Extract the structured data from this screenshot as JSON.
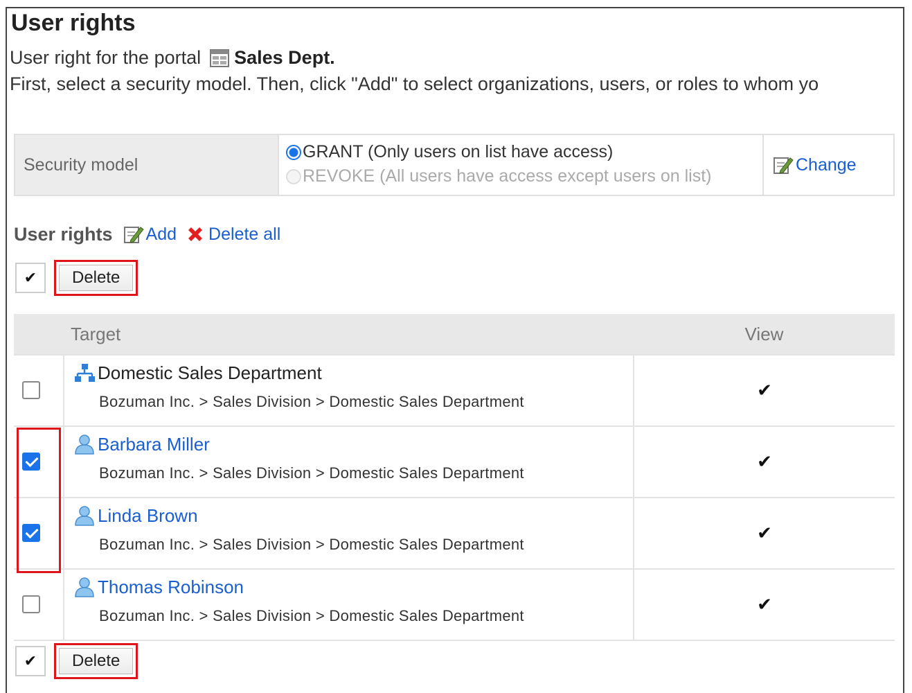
{
  "header": {
    "title": "User rights",
    "portal_prefix": "User right for the portal",
    "portal_name": "Sales Dept.",
    "instruction": "First, select a security model. Then, click \"Add\" to select organizations, users, or roles to whom yo"
  },
  "security": {
    "label": "Security model",
    "grant_label": "GRANT (Only users on list have access)",
    "revoke_label": "REVOKE (All users have access except users on list)",
    "change_label": "Change",
    "selected": "GRANT"
  },
  "user_rights": {
    "title": "User rights",
    "add_label": "Add",
    "delete_all_label": "Delete all"
  },
  "toolbar": {
    "select_all_glyph": "✔",
    "delete_label": "Delete"
  },
  "table": {
    "headers": [
      "",
      "Target",
      "View"
    ],
    "rows": [
      {
        "type": "organization",
        "name": "Domestic Sales Department",
        "path": "Bozuman Inc. > Sales Division > Domestic Sales Department",
        "checked": false,
        "view": "✔"
      },
      {
        "type": "user",
        "name": "Barbara Miller",
        "path": "Bozuman Inc. > Sales Division > Domestic Sales Department",
        "checked": true,
        "view": "✔"
      },
      {
        "type": "user",
        "name": "Linda Brown",
        "path": "Bozuman Inc. > Sales Division > Domestic Sales Department",
        "checked": true,
        "view": "✔"
      },
      {
        "type": "user",
        "name": "Thomas Robinson",
        "path": "Bozuman Inc. > Sales Division > Domestic Sales Department",
        "checked": false,
        "view": "✔"
      }
    ]
  },
  "colors": {
    "link": "#1a5fd0",
    "highlight": "#e0141b",
    "checkbox": "#1a73e8",
    "header_bg": "#e8e8e8"
  },
  "icons": {
    "portal": "portal-icon",
    "edit": "edit-icon",
    "delete": "delete-x-icon",
    "organization": "organization-icon",
    "user": "user-icon"
  }
}
